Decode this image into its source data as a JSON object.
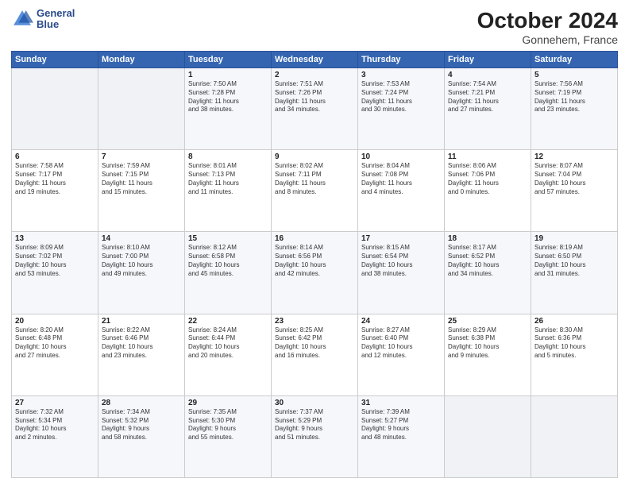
{
  "logo": {
    "line1": "General",
    "line2": "Blue"
  },
  "header": {
    "month": "October 2024",
    "location": "Gonnehem, France"
  },
  "days_of_week": [
    "Sunday",
    "Monday",
    "Tuesday",
    "Wednesday",
    "Thursday",
    "Friday",
    "Saturday"
  ],
  "weeks": [
    [
      {
        "day": "",
        "detail": ""
      },
      {
        "day": "",
        "detail": ""
      },
      {
        "day": "1",
        "detail": "Sunrise: 7:50 AM\nSunset: 7:28 PM\nDaylight: 11 hours\nand 38 minutes."
      },
      {
        "day": "2",
        "detail": "Sunrise: 7:51 AM\nSunset: 7:26 PM\nDaylight: 11 hours\nand 34 minutes."
      },
      {
        "day": "3",
        "detail": "Sunrise: 7:53 AM\nSunset: 7:24 PM\nDaylight: 11 hours\nand 30 minutes."
      },
      {
        "day": "4",
        "detail": "Sunrise: 7:54 AM\nSunset: 7:21 PM\nDaylight: 11 hours\nand 27 minutes."
      },
      {
        "day": "5",
        "detail": "Sunrise: 7:56 AM\nSunset: 7:19 PM\nDaylight: 11 hours\nand 23 minutes."
      }
    ],
    [
      {
        "day": "6",
        "detail": "Sunrise: 7:58 AM\nSunset: 7:17 PM\nDaylight: 11 hours\nand 19 minutes."
      },
      {
        "day": "7",
        "detail": "Sunrise: 7:59 AM\nSunset: 7:15 PM\nDaylight: 11 hours\nand 15 minutes."
      },
      {
        "day": "8",
        "detail": "Sunrise: 8:01 AM\nSunset: 7:13 PM\nDaylight: 11 hours\nand 11 minutes."
      },
      {
        "day": "9",
        "detail": "Sunrise: 8:02 AM\nSunset: 7:11 PM\nDaylight: 11 hours\nand 8 minutes."
      },
      {
        "day": "10",
        "detail": "Sunrise: 8:04 AM\nSunset: 7:08 PM\nDaylight: 11 hours\nand 4 minutes."
      },
      {
        "day": "11",
        "detail": "Sunrise: 8:06 AM\nSunset: 7:06 PM\nDaylight: 11 hours\nand 0 minutes."
      },
      {
        "day": "12",
        "detail": "Sunrise: 8:07 AM\nSunset: 7:04 PM\nDaylight: 10 hours\nand 57 minutes."
      }
    ],
    [
      {
        "day": "13",
        "detail": "Sunrise: 8:09 AM\nSunset: 7:02 PM\nDaylight: 10 hours\nand 53 minutes."
      },
      {
        "day": "14",
        "detail": "Sunrise: 8:10 AM\nSunset: 7:00 PM\nDaylight: 10 hours\nand 49 minutes."
      },
      {
        "day": "15",
        "detail": "Sunrise: 8:12 AM\nSunset: 6:58 PM\nDaylight: 10 hours\nand 45 minutes."
      },
      {
        "day": "16",
        "detail": "Sunrise: 8:14 AM\nSunset: 6:56 PM\nDaylight: 10 hours\nand 42 minutes."
      },
      {
        "day": "17",
        "detail": "Sunrise: 8:15 AM\nSunset: 6:54 PM\nDaylight: 10 hours\nand 38 minutes."
      },
      {
        "day": "18",
        "detail": "Sunrise: 8:17 AM\nSunset: 6:52 PM\nDaylight: 10 hours\nand 34 minutes."
      },
      {
        "day": "19",
        "detail": "Sunrise: 8:19 AM\nSunset: 6:50 PM\nDaylight: 10 hours\nand 31 minutes."
      }
    ],
    [
      {
        "day": "20",
        "detail": "Sunrise: 8:20 AM\nSunset: 6:48 PM\nDaylight: 10 hours\nand 27 minutes."
      },
      {
        "day": "21",
        "detail": "Sunrise: 8:22 AM\nSunset: 6:46 PM\nDaylight: 10 hours\nand 23 minutes."
      },
      {
        "day": "22",
        "detail": "Sunrise: 8:24 AM\nSunset: 6:44 PM\nDaylight: 10 hours\nand 20 minutes."
      },
      {
        "day": "23",
        "detail": "Sunrise: 8:25 AM\nSunset: 6:42 PM\nDaylight: 10 hours\nand 16 minutes."
      },
      {
        "day": "24",
        "detail": "Sunrise: 8:27 AM\nSunset: 6:40 PM\nDaylight: 10 hours\nand 12 minutes."
      },
      {
        "day": "25",
        "detail": "Sunrise: 8:29 AM\nSunset: 6:38 PM\nDaylight: 10 hours\nand 9 minutes."
      },
      {
        "day": "26",
        "detail": "Sunrise: 8:30 AM\nSunset: 6:36 PM\nDaylight: 10 hours\nand 5 minutes."
      }
    ],
    [
      {
        "day": "27",
        "detail": "Sunrise: 7:32 AM\nSunset: 5:34 PM\nDaylight: 10 hours\nand 2 minutes."
      },
      {
        "day": "28",
        "detail": "Sunrise: 7:34 AM\nSunset: 5:32 PM\nDaylight: 9 hours\nand 58 minutes."
      },
      {
        "day": "29",
        "detail": "Sunrise: 7:35 AM\nSunset: 5:30 PM\nDaylight: 9 hours\nand 55 minutes."
      },
      {
        "day": "30",
        "detail": "Sunrise: 7:37 AM\nSunset: 5:29 PM\nDaylight: 9 hours\nand 51 minutes."
      },
      {
        "day": "31",
        "detail": "Sunrise: 7:39 AM\nSunset: 5:27 PM\nDaylight: 9 hours\nand 48 minutes."
      },
      {
        "day": "",
        "detail": ""
      },
      {
        "day": "",
        "detail": ""
      }
    ]
  ]
}
